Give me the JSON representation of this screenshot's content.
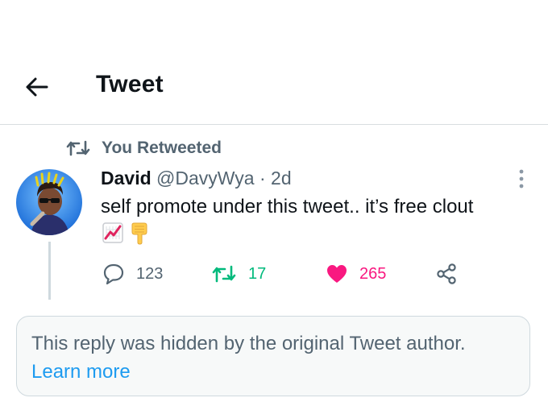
{
  "header": {
    "title": "Tweet",
    "back_icon": "arrow-left-icon"
  },
  "retweet_context": {
    "label": "You Retweeted",
    "icon": "retweet-icon"
  },
  "tweet": {
    "author_name": "David",
    "handle": "@DavyWya",
    "separator": "·",
    "time_ago": "2d",
    "text": "self promote under this tweet.. it’s free clout",
    "emojis": [
      "chart-increasing-emoji",
      "backhand-index-pointing-down-emoji"
    ],
    "avatar_icon": "profile-photo",
    "more_icon": "more-vertical-icon"
  },
  "actions": {
    "reply_count": "123",
    "retweet_count": "17",
    "like_count": "265",
    "like_color": "#f91880",
    "retweet_color": "#00ba7c",
    "share_icon": "share-icon"
  },
  "hidden_notice": {
    "message": "This reply was hidden by the original Tweet author.",
    "link": "Learn more",
    "link_color": "#1d9bf0"
  }
}
